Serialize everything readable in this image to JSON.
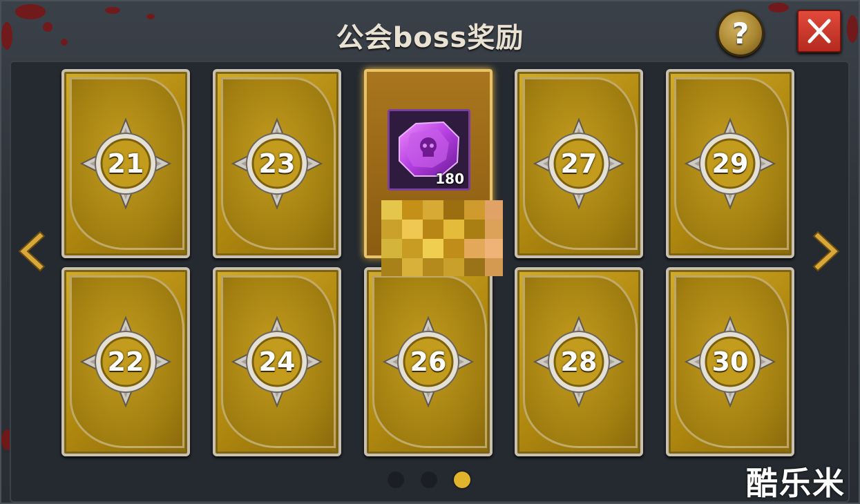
{
  "title": "公会boss奖励",
  "help_label": "?",
  "close_icon": "close-icon",
  "cards": [
    {
      "number": "21"
    },
    {
      "number": "23"
    },
    {
      "number": "27"
    },
    {
      "number": "29"
    },
    {
      "number": "22"
    },
    {
      "number": "24"
    },
    {
      "number": "26"
    },
    {
      "number": "28"
    },
    {
      "number": "30"
    }
  ],
  "revealed_reward": {
    "item_icon": "purple-gem-skull-icon",
    "count": "180"
  },
  "pagination": {
    "total_pages": 3,
    "current_page": 3
  },
  "watermark": "酷乐米",
  "colors": {
    "gold": "#c39c1e",
    "close_red": "#c8352a",
    "active_dot": "#e0b52c",
    "inactive_dot": "#1b1f24"
  }
}
